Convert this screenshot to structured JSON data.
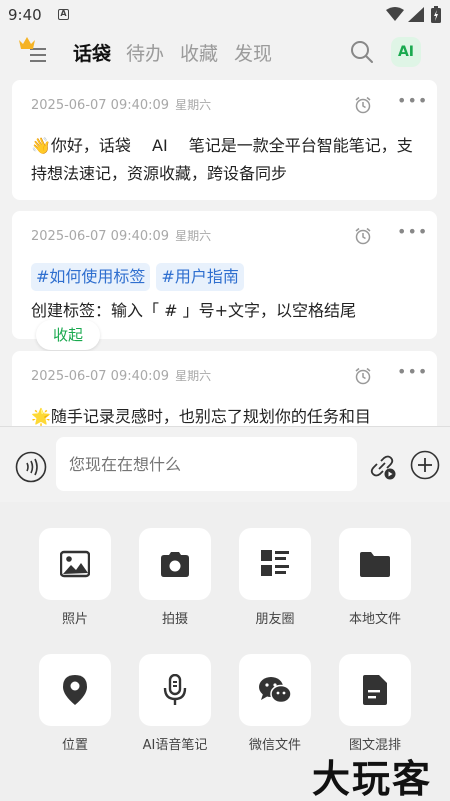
{
  "status_bar": {
    "time": "9:40"
  },
  "tabs": [
    {
      "label": "话袋",
      "active": true
    },
    {
      "label": "待办",
      "active": false
    },
    {
      "label": "收藏",
      "active": false
    },
    {
      "label": "发现",
      "active": false
    }
  ],
  "ai_badge": "AI",
  "cards": [
    {
      "date": "2025-06-07 09:40:09",
      "weekday": "星期六",
      "text": "👋你好，话袋　 AI　 笔记是一款全平台智能笔记，支持想法速记，资源收藏，跨设备同步"
    },
    {
      "date": "2025-06-07 09:40:09",
      "weekday": "星期六",
      "tags": [
        "#如何使用标签",
        "#用户指南"
      ],
      "text": "创建标签：输入「 # 」号+文字，以空格结尾"
    },
    {
      "date": "2025-06-07 09:40:09",
      "weekday": "星期六",
      "text": "🌟随手记录灵感时，也别忘了规划你的任务和目"
    }
  ],
  "collapse_label": "收起",
  "input": {
    "placeholder": "您现在在想什么"
  },
  "actions": [
    {
      "label": "照片",
      "icon": "photo-icon"
    },
    {
      "label": "拍摄",
      "icon": "camera-icon"
    },
    {
      "label": "朋友圈",
      "icon": "moments-icon"
    },
    {
      "label": "本地文件",
      "icon": "folder-icon"
    },
    {
      "label": "位置",
      "icon": "location-icon"
    },
    {
      "label": "AI语音笔记",
      "icon": "microphone-icon"
    },
    {
      "label": "微信文件",
      "icon": "wechat-icon"
    },
    {
      "label": "图文混排",
      "icon": "document-icon"
    }
  ],
  "watermark": "大玩客",
  "colors": {
    "accent": "#1aa94f",
    "tag_text": "#2f6fcf",
    "tag_bg": "#e8f1fc"
  }
}
